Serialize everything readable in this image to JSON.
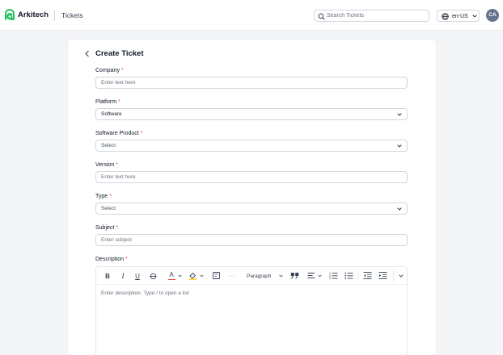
{
  "header": {
    "brand": "Arkitech",
    "section_title": "Tickets",
    "search_placeholder": "Search Tickets",
    "language": "en-US",
    "avatar_initials": "CA"
  },
  "page": {
    "title": "Create Ticket"
  },
  "form": {
    "company": {
      "label": "Company",
      "placeholder": "Enter text here"
    },
    "platform": {
      "label": "Platform",
      "value": "Software"
    },
    "software_product": {
      "label": "Software Product",
      "value": "Select"
    },
    "version": {
      "label": "Version",
      "placeholder": "Enter text here"
    },
    "type": {
      "label": "Type",
      "value": "Select"
    },
    "subject": {
      "label": "Subject",
      "placeholder": "Enter subject"
    },
    "description": {
      "label": "Description",
      "placeholder": "Enter description. Type / to open a list",
      "toolbar": {
        "bold": "B",
        "italic": "I",
        "underline": "U",
        "strikethrough": "S",
        "font_color": "A",
        "more": "···",
        "block_type": "Paragraph"
      }
    },
    "required_marker": "*"
  },
  "colors": {
    "brand_green": "#22c55e",
    "required_red": "#ef4444",
    "font_color_underline": "#ef4444",
    "highlight_yellow": "#facc15",
    "avatar_bg": "#64748b"
  },
  "icons": {
    "brand": "arkitech-logo-icon",
    "search": "search-icon",
    "language": "globe-icon",
    "back": "chevron-left-icon",
    "dropdown": "chevron-down-icon"
  }
}
